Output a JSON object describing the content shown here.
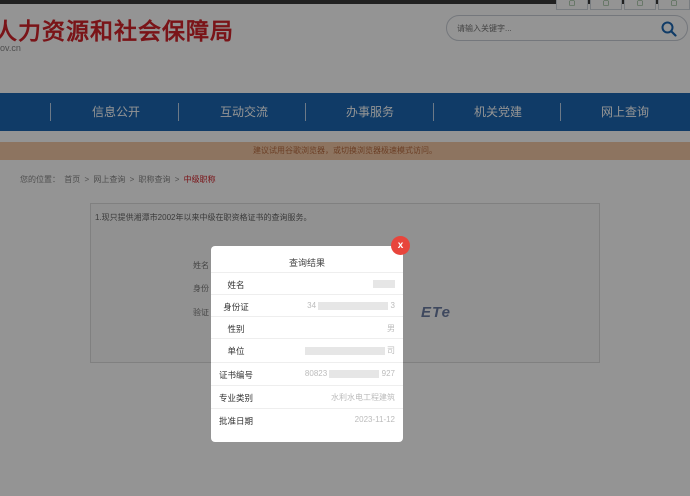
{
  "header": {
    "site_title": "人力资源和社会保障局",
    "domain_suffix": "ov.cn",
    "search_placeholder": "请输入关键字..."
  },
  "nav": {
    "items": [
      "信息公开",
      "互动交流",
      "办事服务",
      "机关党建",
      "网上查询"
    ]
  },
  "notice": "建议试用谷歌浏览器，或切换浏览器极速模式访问。",
  "breadcrumb": {
    "prefix": "您的位置：",
    "items": [
      "首页",
      ">",
      "网上查询",
      ">",
      "职称查询",
      ">"
    ],
    "current": "中级职称"
  },
  "content": {
    "note": "1.现只提供湘潭市2002年以来中级在职资格证书的查询服务。",
    "labels": [
      "姓名",
      "身份",
      "验证"
    ],
    "captcha": "ETe"
  },
  "modal": {
    "title": "查询结果",
    "close": "x",
    "rows": [
      {
        "label": "姓名",
        "prefix": "",
        "suffix": ""
      },
      {
        "label": "身份证",
        "prefix": "34",
        "suffix": "3"
      },
      {
        "label": "性别",
        "prefix": "",
        "suffix": "男"
      },
      {
        "label": "单位",
        "prefix": "",
        "suffix": "司"
      },
      {
        "label": "证书编号",
        "prefix": "80823",
        "suffix": "927"
      },
      {
        "label": "专业类别",
        "prefix": "",
        "suffix": "水利水电工程建筑"
      },
      {
        "label": "批准日期",
        "prefix": "",
        "suffix": "2023-11-12"
      }
    ]
  },
  "colors": {
    "brand_red": "#d2232a",
    "nav_blue": "#1c67b1",
    "notice_bg": "#f3c8a5",
    "close_red": "#e8453c"
  }
}
